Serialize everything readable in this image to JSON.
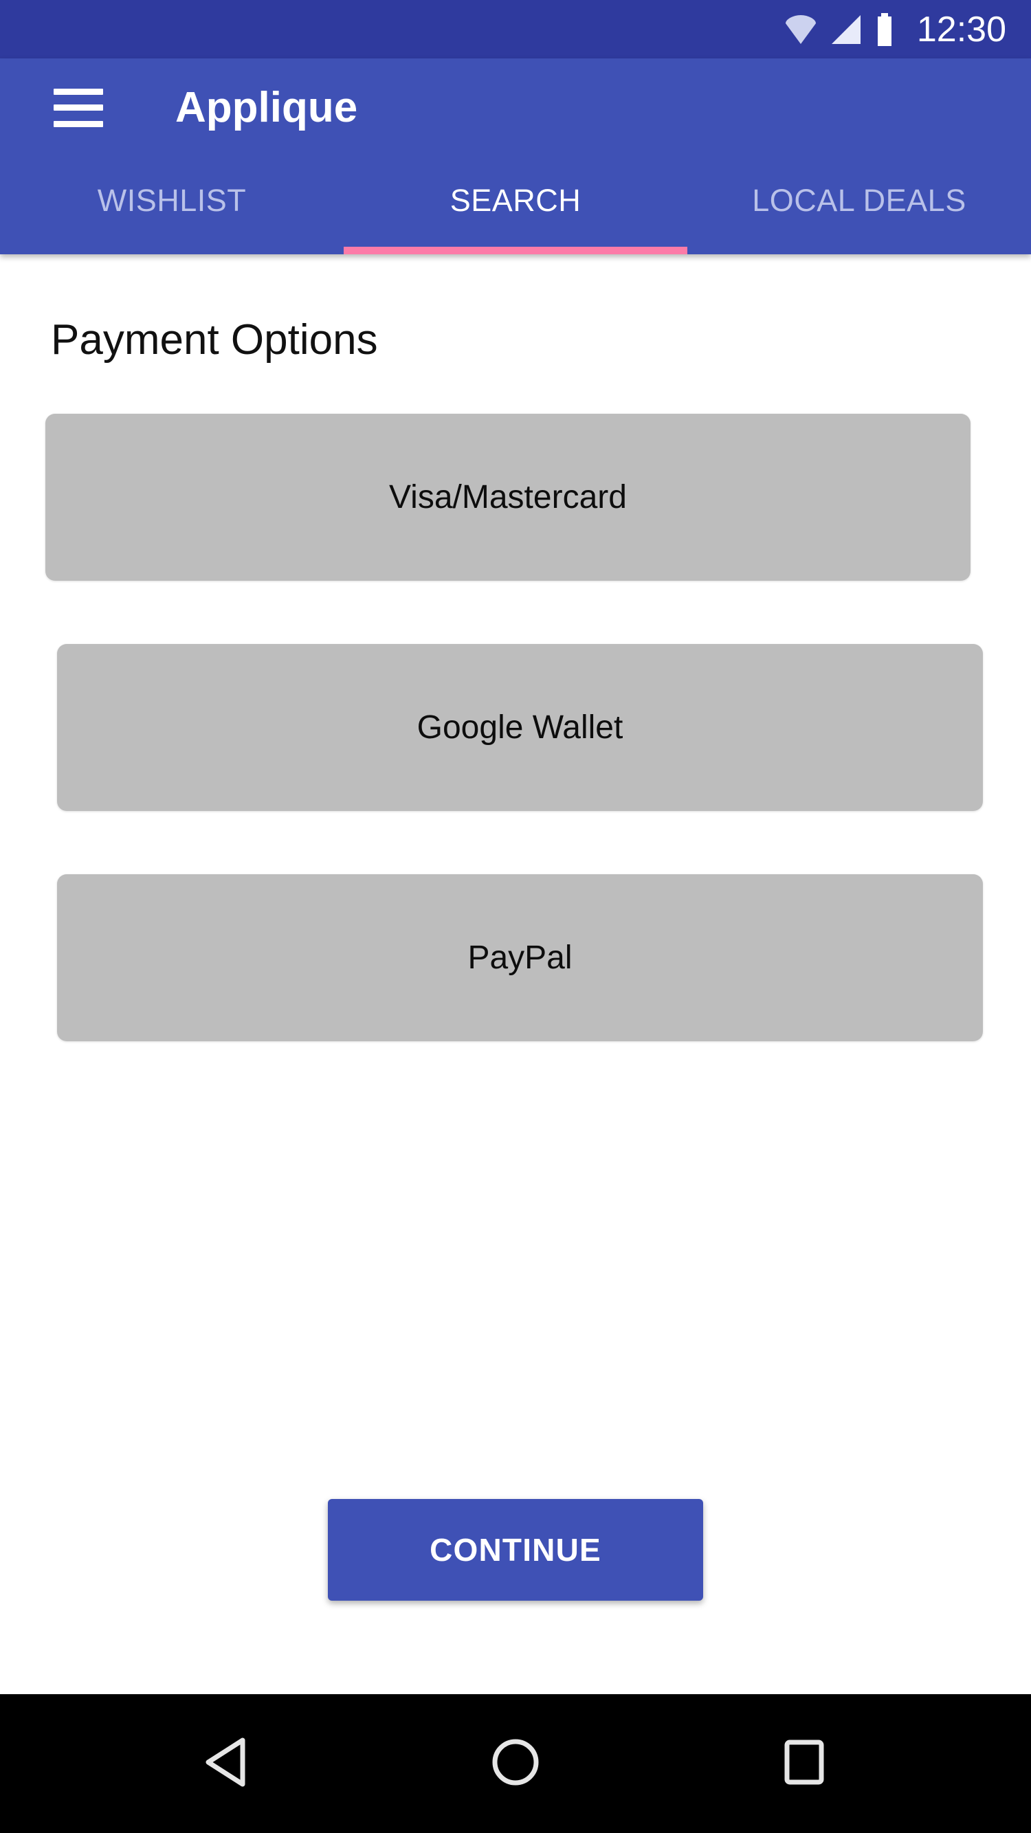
{
  "status_bar": {
    "time": "12:30",
    "icons": [
      "wifi-icon",
      "signal-icon",
      "battery-icon"
    ],
    "background_color": "#2f3a9e"
  },
  "app_bar": {
    "menu_icon": "hamburger-menu-icon",
    "title": "Applique",
    "background_color": "#3f51b5"
  },
  "tabs": {
    "items": [
      {
        "label": "WISHLIST",
        "active": false
      },
      {
        "label": "SEARCH",
        "active": true
      },
      {
        "label": "LOCAL DEALS",
        "active": false
      }
    ],
    "indicator_color": "#fc7ba8",
    "active_text_color": "#ffffff",
    "inactive_text_color": "#b9c1e9"
  },
  "main": {
    "page_title": "Payment Options",
    "payment_options": [
      {
        "label": "Visa/Mastercard"
      },
      {
        "label": "Google Wallet"
      },
      {
        "label": "PayPal"
      }
    ],
    "option_background_color": "#bdbdbd",
    "continue_label": "CONTINUE",
    "continue_color": "#3f51b5"
  },
  "nav_bar": {
    "buttons": [
      {
        "name": "back-button",
        "icon": "back-triangle-icon"
      },
      {
        "name": "home-button",
        "icon": "home-circle-icon"
      },
      {
        "name": "recents-button",
        "icon": "recents-square-icon"
      }
    ],
    "background_color": "#000000"
  }
}
